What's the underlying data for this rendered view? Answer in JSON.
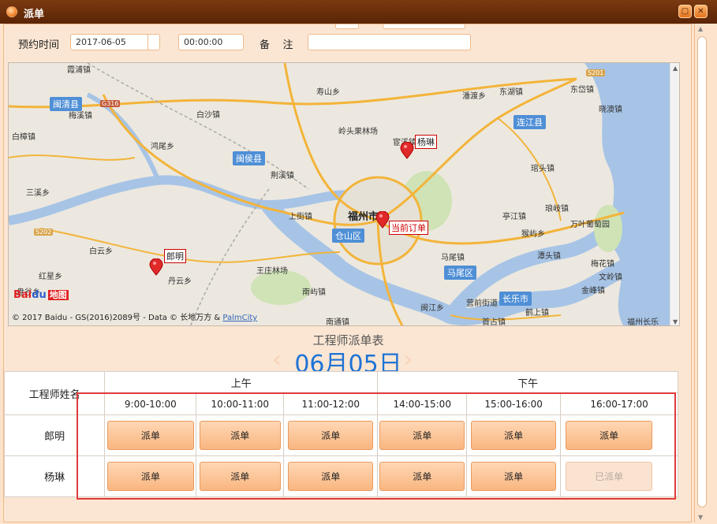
{
  "window": {
    "title": "派单"
  },
  "form": {
    "date_label": "预约时间",
    "date_value": "2017-06-05",
    "time_value": "00:00:00",
    "note_label": "备    注",
    "note_value": ""
  },
  "map": {
    "places": [
      "寿山乡",
      "潘渡乡",
      "东湖镇",
      "东岱镇",
      "晓澳镇",
      "白沙镇",
      "梅溪镇",
      "白樟镇",
      "鸿尾乡",
      "岭头果林场",
      "宦溪镇",
      "上街镇",
      "荆溪镇",
      "福州市",
      "三溪乡",
      "白云乡",
      "丹云乡",
      "红星乡",
      "王庄林场",
      "南屿镇",
      "南通镇",
      "闽江乡",
      "营前街道",
      "首占镇",
      "鹤上镇",
      "马尾镇",
      "亭江镇",
      "猴屿乡",
      "琯头镇",
      "琅岐镇",
      "万叶葡萄园",
      "潭头镇",
      "梅花镇",
      "文岭镇",
      "金峰镇",
      "福州长乐",
      "盘谷乡",
      "霞浦镇"
    ],
    "counties": [
      "闽清县",
      "闽侯县",
      "连江县",
      "仓山区",
      "马尾区",
      "长乐市"
    ],
    "highways": [
      "G316",
      "S201",
      "S202"
    ],
    "pins": [
      {
        "label": "杨琳"
      },
      {
        "label": "当前订单"
      },
      {
        "label": "郎明"
      }
    ],
    "logo_text": "Bai",
    "logo_text2": "地图",
    "copyright": "© 2017 Baidu - GS(2016)2089号 - Data © 长地万方 & ",
    "copyright_link": "PalmCity"
  },
  "schedule": {
    "title": "工程师派单表",
    "date": "06月05日",
    "name_header": "工程师姓名",
    "am_label": "上午",
    "pm_label": "下午",
    "slots": [
      "9:00-10:00",
      "10:00-11:00",
      "11:00-12:00",
      "14:00-15:00",
      "15:00-16:00",
      "16:00-17:00"
    ],
    "engineers": [
      {
        "name": "郎明",
        "actions": [
          "派单",
          "派单",
          "派单",
          "派单",
          "派单",
          "派单"
        ]
      },
      {
        "name": "杨琳",
        "actions": [
          "派单",
          "派单",
          "派单",
          "派单",
          "派单",
          "已派单"
        ]
      }
    ]
  },
  "colors": {
    "accent": "#1e73d6",
    "titlebar": "#6a2e0a",
    "button": "#f9b680",
    "highlight": "#e03a3a"
  }
}
